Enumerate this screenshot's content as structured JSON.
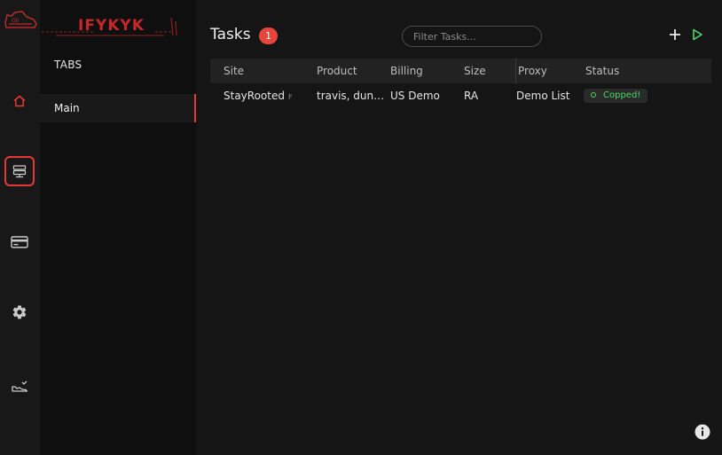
{
  "brand": {
    "name": "IFYKYK"
  },
  "rail": {
    "items": [
      {
        "icon": "home-icon",
        "active": false
      },
      {
        "icon": "server-icon",
        "active": true
      },
      {
        "icon": "credit-card-icon",
        "active": false
      },
      {
        "icon": "gear-icon",
        "active": false
      },
      {
        "icon": "sneaker-icon",
        "active": false
      }
    ]
  },
  "tabs": {
    "heading": "TABS",
    "items": [
      {
        "label": "Main",
        "active": true
      }
    ]
  },
  "main": {
    "title": "Tasks",
    "count": "1",
    "filter_placeholder": "Filter Tasks...",
    "columns": [
      "Site",
      "Product",
      "Billing",
      "Size",
      "Proxy",
      "Status"
    ],
    "rows": [
      {
        "site": "StayRooted",
        "site_flag": "F",
        "product": "travis, dunk,yeezy",
        "billing": "US Demo",
        "size": "RA",
        "proxy": "Demo List",
        "status": "Copped!"
      }
    ]
  },
  "colors": {
    "accent": "#e53935",
    "success": "#4cd964",
    "background": "#151515"
  }
}
